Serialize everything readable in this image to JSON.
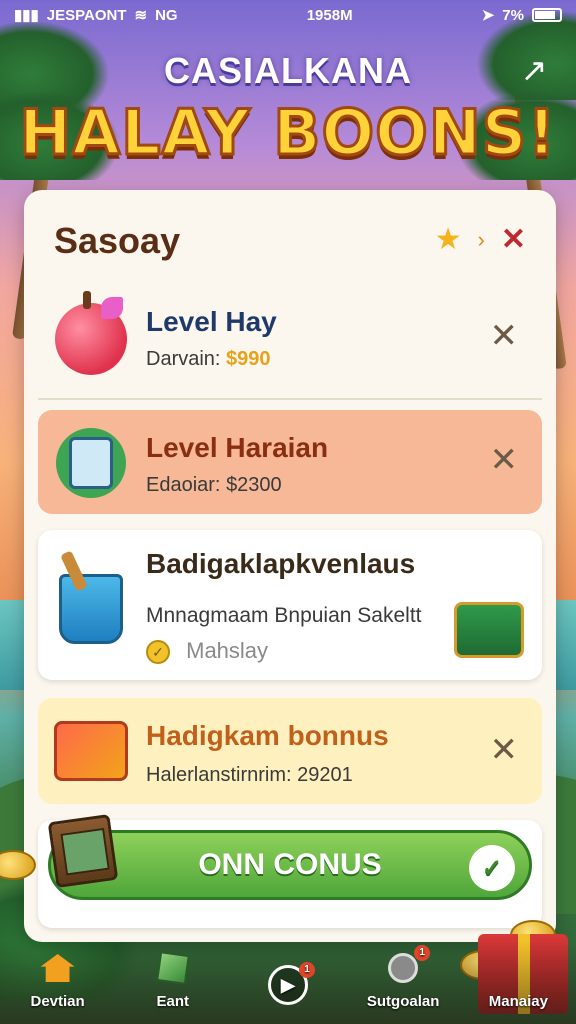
{
  "status_bar": {
    "carrier": "JESPAONT",
    "network": "NG",
    "time": "1958M",
    "battery": "7%"
  },
  "header": {
    "subtitle": "CASIALKANA",
    "title": "HALAY BOONS!"
  },
  "panel": {
    "title": "Sasoay",
    "cards": [
      {
        "title": "Level Hay",
        "subtitle_prefix": "Darvain: ",
        "subtitle_value": "$990",
        "title_color": "#1f3a6a",
        "value_color": "#e6a21a"
      },
      {
        "title": "Level Haraian",
        "subtitle_prefix": "Edaoiar: ",
        "subtitle_value": "$2300",
        "title_color": "#8a2e12",
        "value_color": "#3a3a3a"
      },
      {
        "title": "Badigaklapkvenlaus",
        "subtitle": "Mnnagmaam Bnpuian Sakeltt",
        "badge_text": "Mahslay",
        "title_color": "#3a2a1a"
      },
      {
        "title": "Hadigkam bonnus",
        "subtitle_prefix": "Halerlanstirnrim: ",
        "subtitle_value": "29201",
        "title_color": "#c0601a",
        "value_color": "#3a3a3a"
      }
    ],
    "cta": {
      "label": "ONN CONUS"
    }
  },
  "bottom_nav": {
    "items": [
      {
        "label": "Devtian"
      },
      {
        "label": "Eant"
      },
      {
        "label": ""
      },
      {
        "label": "Sutgoalan"
      },
      {
        "label": "Manaiay"
      }
    ]
  }
}
